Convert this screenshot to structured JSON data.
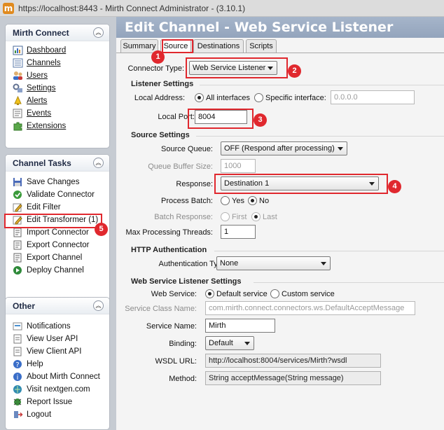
{
  "window": {
    "title": "https://localhost:8443 - Mirth Connect Administrator - (3.10.1)",
    "icon": "mirth-app-icon"
  },
  "sidebar": {
    "mirth": {
      "title": "Mirth Connect",
      "items": [
        {
          "label": "Dashboard",
          "icon": "dashboard-icon"
        },
        {
          "label": "Channels",
          "icon": "channels-icon"
        },
        {
          "label": "Users",
          "icon": "users-icon"
        },
        {
          "label": "Settings",
          "icon": "settings-icon"
        },
        {
          "label": "Alerts",
          "icon": "alerts-icon"
        },
        {
          "label": "Events",
          "icon": "events-icon"
        },
        {
          "label": "Extensions",
          "icon": "extensions-icon"
        }
      ]
    },
    "tasks": {
      "title": "Channel Tasks",
      "items": [
        {
          "label": "Save Changes",
          "icon": "save-icon"
        },
        {
          "label": "Validate Connector",
          "icon": "validate-icon"
        },
        {
          "label": "Edit Filter",
          "icon": "edit-filter-icon"
        },
        {
          "label": "Edit Transformer (1)",
          "icon": "edit-transformer-icon"
        },
        {
          "label": "Import Connector",
          "icon": "import-icon"
        },
        {
          "label": "Export Connector",
          "icon": "export-icon"
        },
        {
          "label": "Export Channel",
          "icon": "export-channel-icon"
        },
        {
          "label": "Deploy Channel",
          "icon": "deploy-icon"
        }
      ]
    },
    "other": {
      "title": "Other",
      "items": [
        {
          "label": "Notifications",
          "icon": "notifications-icon"
        },
        {
          "label": "View User API",
          "icon": "user-api-icon"
        },
        {
          "label": "View Client API",
          "icon": "client-api-icon"
        },
        {
          "label": "Help",
          "icon": "help-icon"
        },
        {
          "label": "About Mirth Connect",
          "icon": "about-icon"
        },
        {
          "label": "Visit nextgen.com",
          "icon": "visit-icon"
        },
        {
          "label": "Report Issue",
          "icon": "report-issue-icon"
        },
        {
          "label": "Logout",
          "icon": "logout-icon"
        }
      ]
    }
  },
  "main": {
    "header": "Edit Channel - Web Service Listener Channel",
    "tabs": [
      "Summary",
      "Source",
      "Destinations",
      "Scripts"
    ],
    "connector_type_label": "Connector Type:",
    "connector_type": "Web Service Listener",
    "listener": {
      "title": "Listener Settings",
      "local_address_label": "Local Address:",
      "all_interfaces": "All interfaces",
      "specific_interface": "Specific interface:",
      "interface_value": "0.0.0.0",
      "local_port_label": "Local Port:",
      "local_port": "8004"
    },
    "source": {
      "title": "Source Settings",
      "queue_label": "Source Queue:",
      "queue_value": "OFF (Respond after processing)",
      "buffer_label": "Queue Buffer Size:",
      "buffer_value": "1000",
      "response_label": "Response:",
      "response_value": "Destination 1",
      "process_batch_label": "Process Batch:",
      "yes": "Yes",
      "no": "No",
      "batch_response_label": "Batch Response:",
      "first": "First",
      "last": "Last",
      "max_threads_label": "Max Processing Threads:",
      "max_threads": "1"
    },
    "http": {
      "title": "HTTP Authentication",
      "auth_label": "Authentication Type:",
      "auth_value": "None"
    },
    "ws": {
      "title": "Web Service Listener Settings",
      "web_service_label": "Web Service:",
      "default_service": "Default service",
      "custom_service": "Custom service",
      "class_name_label": "Service Class Name:",
      "class_name": "com.mirth.connect.connectors.ws.DefaultAcceptMessage",
      "service_name_label": "Service Name:",
      "service_name": "Mirth",
      "binding_label": "Binding:",
      "binding": "Default",
      "wsdl_label": "WSDL URL:",
      "wsdl": "http://localhost:8004/services/Mirth?wsdl",
      "method_label": "Method:",
      "method": "String acceptMessage(String message)"
    }
  },
  "annotations": [
    "1",
    "2",
    "3",
    "4",
    "5"
  ],
  "colors": {
    "annotation": "#e0282e",
    "header": "#98a8c0",
    "sidebar_bg": "#c6cbd2"
  }
}
